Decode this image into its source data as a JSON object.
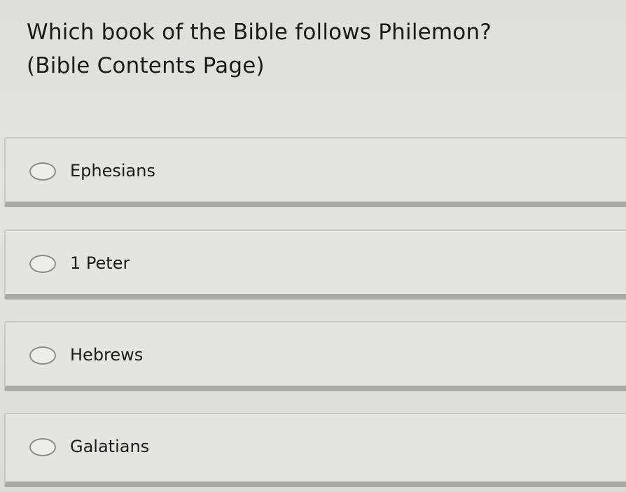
{
  "question": {
    "line1": "Which book of the Bible follows Philemon?",
    "line2": "(Bible Contents Page)"
  },
  "options": [
    {
      "label": "Ephesians",
      "selected": false
    },
    {
      "label": "1 Peter",
      "selected": false
    },
    {
      "label": "Hebrews",
      "selected": false
    },
    {
      "label": "Galatians",
      "selected": false
    }
  ]
}
